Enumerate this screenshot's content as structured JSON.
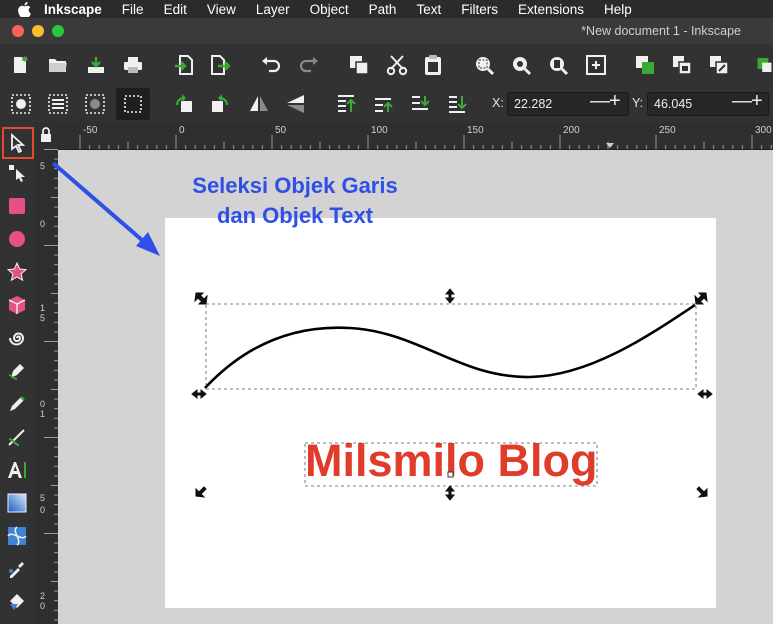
{
  "menubar": {
    "app": "Inkscape",
    "items": [
      "File",
      "Edit",
      "View",
      "Layer",
      "Object",
      "Path",
      "Text",
      "Filters",
      "Extensions",
      "Help"
    ]
  },
  "window": {
    "title": "*New document 1 - Inkscape"
  },
  "coords": {
    "x_label": "X:",
    "x_value": "22.282",
    "y_label": "Y:",
    "y_value": "46.045"
  },
  "ruler": {
    "top_ticks": [
      "-50",
      "0",
      "50",
      "100",
      "150",
      "200",
      "250",
      "300"
    ]
  },
  "ruler_left_ticks": [
    "5",
    "0",
    "1",
    "5",
    "0",
    "1",
    "5",
    "0",
    "2",
    "0"
  ],
  "annotation": {
    "line1": "Seleksi Objek Garis",
    "line2": "dan Objek  Text"
  },
  "canvas": {
    "blog_text": "Milsmilo Blog"
  },
  "colors": {
    "accent": "#e04a2f",
    "annotation": "#2f4fe6",
    "text_object": "#e03c2c",
    "green_icon": "#3aa935"
  },
  "tools": [
    "selector-tool",
    "node-tool",
    "rect-tool",
    "ellipse-tool",
    "star-tool",
    "3dbox-tool",
    "spiral-tool",
    "pen-tool",
    "pencil-tool",
    "calligraphy-tool",
    "text-tool",
    "gradient-tool",
    "mesh-tool",
    "dropper-tool",
    "bucket-tool"
  ]
}
